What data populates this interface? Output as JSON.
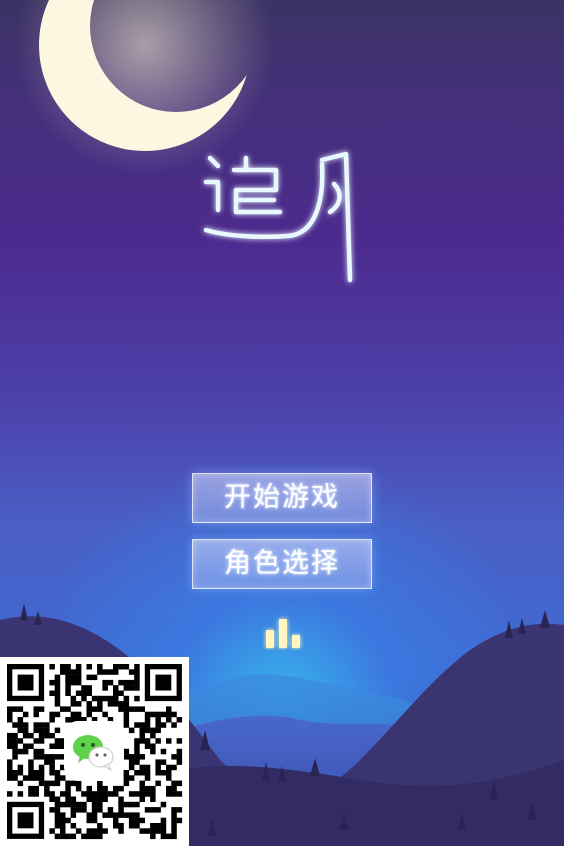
{
  "title": {
    "logo_text": "追月"
  },
  "menu": {
    "start_label": "开始游戏",
    "role_label": "角色选择"
  },
  "icons": {
    "leaderboard": "leaderboard-icon",
    "moon": "crescent-moon",
    "wechat": "wechat-icon"
  },
  "colors": {
    "button_text": "#ffffff",
    "moon": "#fdf7e2",
    "title_glow": "#bfeaff",
    "icon_glow": "#fff7c4"
  }
}
